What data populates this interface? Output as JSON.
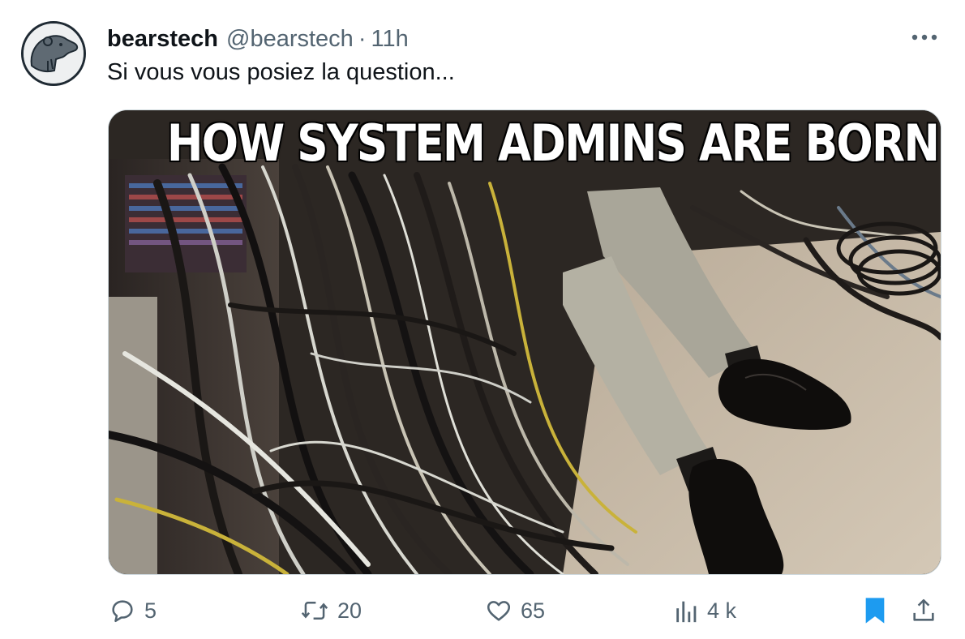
{
  "tweet": {
    "display_name": "bearstech",
    "handle": "@bearstech",
    "separator": "·",
    "time": "11h",
    "text": "Si vous vous posiez la question...",
    "media": {
      "caption": "HOW SYSTEM ADMINS ARE BORN"
    }
  },
  "actions": {
    "replies": "5",
    "reposts": "20",
    "likes": "65",
    "views": "4 k"
  },
  "icons": {
    "more": "more-horizontal-icon",
    "reply": "comment-bubble-icon",
    "repost": "repost-arrows-icon",
    "like": "heart-icon",
    "views": "bar-chart-icon",
    "bookmark": "bookmark-filled-icon",
    "share": "share-upload-icon"
  },
  "colors": {
    "text_primary": "#0f1419",
    "text_secondary": "#536471",
    "bookmark_active": "#1d9bf0"
  }
}
